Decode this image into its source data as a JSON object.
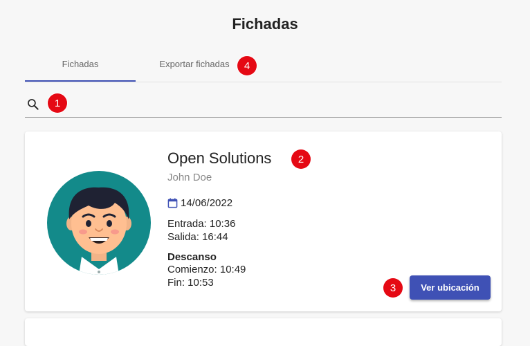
{
  "header": {
    "title": "Fichadas"
  },
  "tabs": [
    {
      "label": "Fichadas",
      "active": true
    },
    {
      "label": "Exportar fichadas",
      "active": false
    }
  ],
  "badges": {
    "search": "1",
    "company": "2",
    "location": "3",
    "export": "4"
  },
  "search": {
    "value": "",
    "placeholder": "",
    "icon": "search-icon"
  },
  "card": {
    "company": "Open Solutions",
    "user": "John Doe",
    "date": "14/06/2022",
    "entrada": "Entrada: 10:36",
    "salida": "Salida: 16:44",
    "descanso_title": "Descanso",
    "comienzo": "Comienzo: 10:49",
    "fin": "Fin: 10:53",
    "button_label": "Ver ubicación"
  },
  "colors": {
    "accent": "#3f51b5",
    "badge": "#e50914",
    "avatar_bg": "#138a8a"
  }
}
